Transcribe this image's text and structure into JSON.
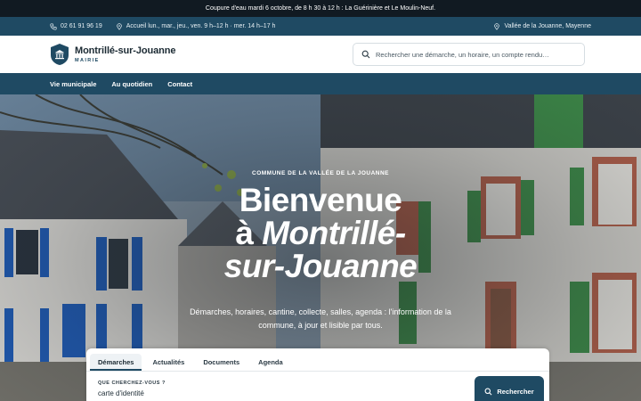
{
  "alert": {
    "text": "Coupure d'eau mardi 6 octobre, de 8 h 30 à 12 h : La Guérinière et Le Moulin-Neuf."
  },
  "infobar": {
    "phone": "02 61 91 96 19",
    "hours": "Accueil lun., mar., jeu., ven. 9 h–12 h · mer. 14 h–17 h",
    "location": "Vallée de la Jouanne, Mayenne"
  },
  "header": {
    "site_name": "Montrillé-sur-Jouanne",
    "site_sub": "MAIRIE",
    "search_placeholder": "Rechercher une démarche, un horaire, un compte rendu…"
  },
  "nav": {
    "items": [
      {
        "label": "Vie municipale"
      },
      {
        "label": "Au quotidien"
      },
      {
        "label": "Contact"
      }
    ]
  },
  "hero": {
    "kicker": "COMMUNE DE LA VALLÉE DE LA JOUANNE",
    "title_line1": "Bienvenue",
    "title_line2_prefix": "à ",
    "title_line2_em": "Montrillé-",
    "title_line3": "sur-Jouanne",
    "subtitle": "Démarches, horaires, cantine, collecte, salles, agenda : l'information de la commune, à jour et lisible par tous."
  },
  "panel": {
    "tabs": [
      {
        "label": "Démarches"
      },
      {
        "label": "Actualités"
      },
      {
        "label": "Documents"
      },
      {
        "label": "Agenda"
      }
    ],
    "active_tab": "Démarches",
    "question_label": "QUE CHERCHEZ-VOUS ?",
    "query_value": "carte d'identité",
    "search_button": "Rechercher"
  },
  "colors": {
    "primary": "#1f4a63",
    "alert_bg": "#111a22",
    "shutters_blue": "#1f5fbf",
    "shutters_green": "#3f8f4a"
  }
}
